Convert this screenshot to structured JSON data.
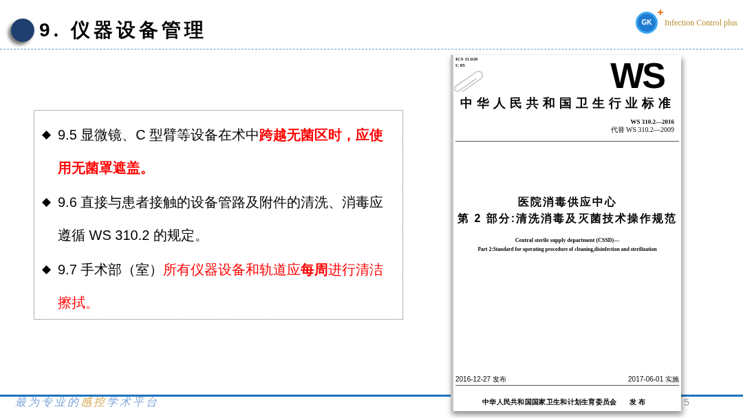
{
  "header": {
    "title": "9. 仪器设备管理"
  },
  "logo": {
    "mark": "GK",
    "text": "Infection Control plus"
  },
  "content_box": {
    "items": [
      {
        "segments": [
          {
            "text": "9.5 显微镜、C 型臂等设备在术中",
            "kind": "normal"
          },
          {
            "text": "跨越无菌区时，应使用无菌罩遮盖。",
            "kind": "alert_bold"
          }
        ]
      },
      {
        "segments": [
          {
            "text": "9.6 直接与患者接触的设备管路及附件的清洗、消毒应遵循 WS 310.2 的规定。",
            "kind": "normal"
          }
        ]
      },
      {
        "segments": [
          {
            "text": "9.7 手术部（室）",
            "kind": "normal"
          },
          {
            "text": "所有仪器设备和轨道应",
            "kind": "alert"
          },
          {
            "text": "每周",
            "kind": "alert_bold"
          },
          {
            "text": "进行清洁擦拭。",
            "kind": "alert"
          }
        ]
      }
    ]
  },
  "document": {
    "classification": [
      "ICS 11.020",
      "C 05"
    ],
    "code_mark": "WS",
    "title": "中华人民共和国卫生行业标准",
    "standard_number": "WS 310.2—2016",
    "replaces": "代替 WS 310.2—2009",
    "title_cn": [
      "医院消毒供应中心",
      "第 2 部分:清洗消毒及灭菌技术操作规范"
    ],
    "title_en": [
      "Central sterile supply department (CSSD)—",
      "Part 2:Standard for operating procedure of cleaning,disinfection and sterilization"
    ],
    "issue_date": "2016-12-27 发布",
    "effective_date": "2017-06-01 实施",
    "issuer": "中华人民共和国国家卫生和计划生育委员会",
    "issuer_action": "发 布"
  },
  "footer": {
    "slogan": [
      {
        "text": "最为专业的",
        "kind": "normal"
      },
      {
        "text": "感控",
        "kind": "accent"
      },
      {
        "text": "学术平台",
        "kind": "normal"
      }
    ],
    "page_number": "5"
  }
}
